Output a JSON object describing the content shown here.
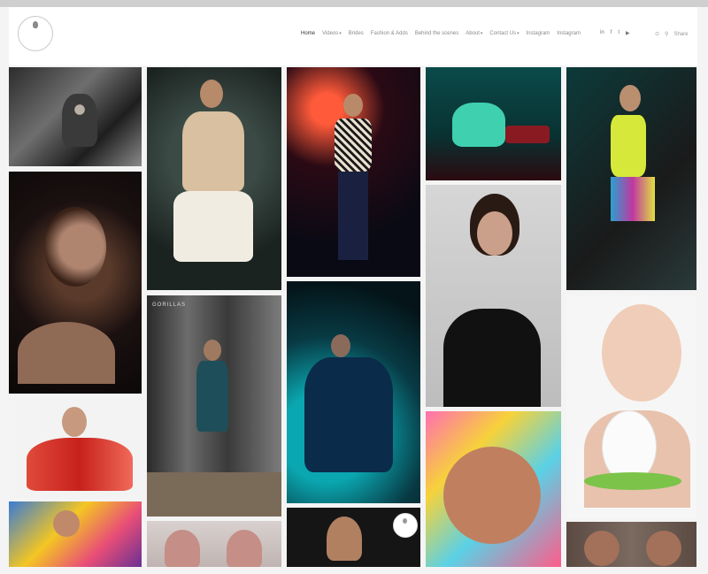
{
  "header": {
    "logo_text": "",
    "nav": [
      {
        "label": "Home",
        "active": true,
        "caret": false
      },
      {
        "label": "Videos",
        "active": false,
        "caret": true
      },
      {
        "label": "Brides",
        "active": false,
        "caret": false
      },
      {
        "label": "Fashion & Adds",
        "active": false,
        "caret": false
      },
      {
        "label": "Behind the scenes",
        "active": false,
        "caret": false
      },
      {
        "label": "About",
        "active": false,
        "caret": true
      },
      {
        "label": "Contact Us",
        "active": false,
        "caret": true
      },
      {
        "label": "Instagram",
        "active": false,
        "caret": false
      },
      {
        "label": "Instagram",
        "active": false,
        "caret": false
      }
    ],
    "social_icons": [
      "linkedin-icon",
      "facebook-icon",
      "twitter-icon",
      "youtube-icon"
    ],
    "share_label": "Share"
  },
  "gallery": {
    "tile_labels": {
      "gorillas": "GORILLAS"
    }
  },
  "colors": {
    "accent": "#1aa3a3",
    "background": "#f4f4f4"
  }
}
